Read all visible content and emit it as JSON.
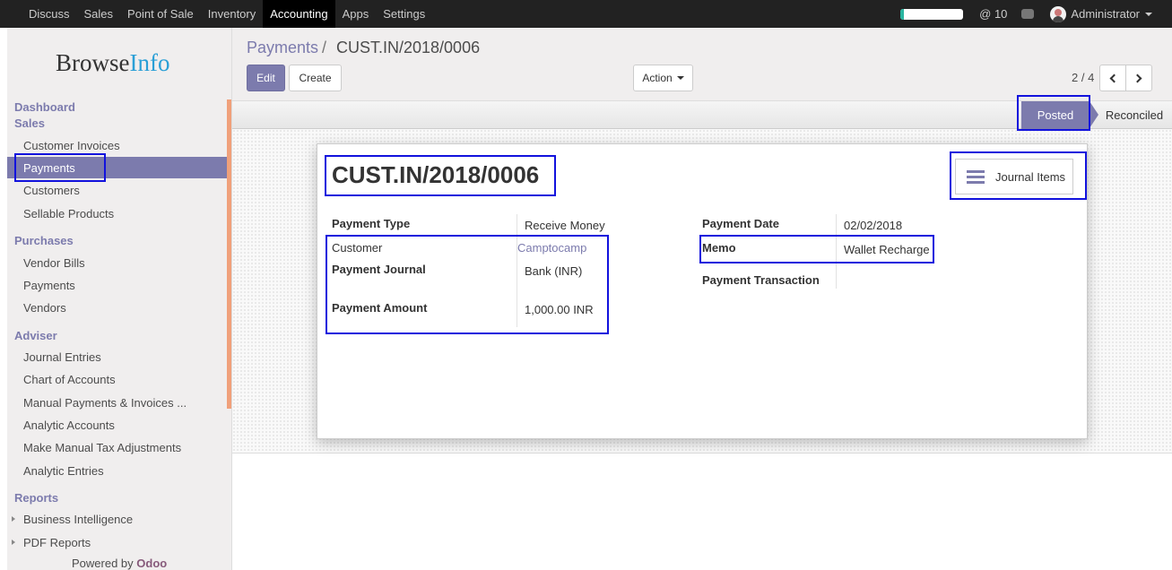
{
  "topbar": {
    "menu": [
      "Discuss",
      "Sales",
      "Point of Sale",
      "Inventory",
      "Accounting",
      "Apps",
      "Settings"
    ],
    "active_index": 4,
    "progress_fraction": 0.05,
    "mentions": "@ 10",
    "user": "Administrator"
  },
  "sidebar": {
    "logo_main": "Browse",
    "logo_accent": "Info",
    "sections": {
      "dashboard": "Dashboard",
      "sales": "Sales",
      "purchases": "Purchases",
      "adviser": "Adviser",
      "reports": "Reports"
    },
    "sales_items": [
      "Customer Invoices",
      "Payments",
      "Customers",
      "Sellable Products"
    ],
    "purchases_items": [
      "Vendor Bills",
      "Payments",
      "Vendors"
    ],
    "adviser_items": [
      "Journal Entries",
      "Chart of Accounts",
      "Manual Payments & Invoices ...",
      "Analytic Accounts",
      "Make Manual Tax Adjustments",
      "Analytic Entries"
    ],
    "reports_items": [
      "Business Intelligence",
      "PDF Reports"
    ],
    "powered_by": "Powered by",
    "powered_brand": "Odoo"
  },
  "control": {
    "breadcrumb_link": "Payments",
    "breadcrumb_sep": "/",
    "breadcrumb_current": "CUST.IN/2018/0006",
    "edit_label": "Edit",
    "create_label": "Create",
    "action_label": "Action",
    "pager": "2 / 4"
  },
  "status": {
    "posted": "Posted",
    "reconciled": "Reconciled"
  },
  "form": {
    "title": "CUST.IN/2018/0006",
    "smart_button": "Journal Items",
    "left": {
      "payment_type_label": "Payment Type",
      "payment_type_value": "Receive Money",
      "customer_label": "Customer",
      "customer_value": "Camptocamp",
      "journal_label": "Payment Journal",
      "journal_value": "Bank (INR)",
      "amount_label": "Payment Amount",
      "amount_value": "1,000.00 INR"
    },
    "right": {
      "date_label": "Payment Date",
      "date_value": "02/02/2018",
      "memo_label": "Memo",
      "memo_value": "Wallet Recharge",
      "transaction_label": "Payment Transaction",
      "transaction_value": ""
    }
  }
}
